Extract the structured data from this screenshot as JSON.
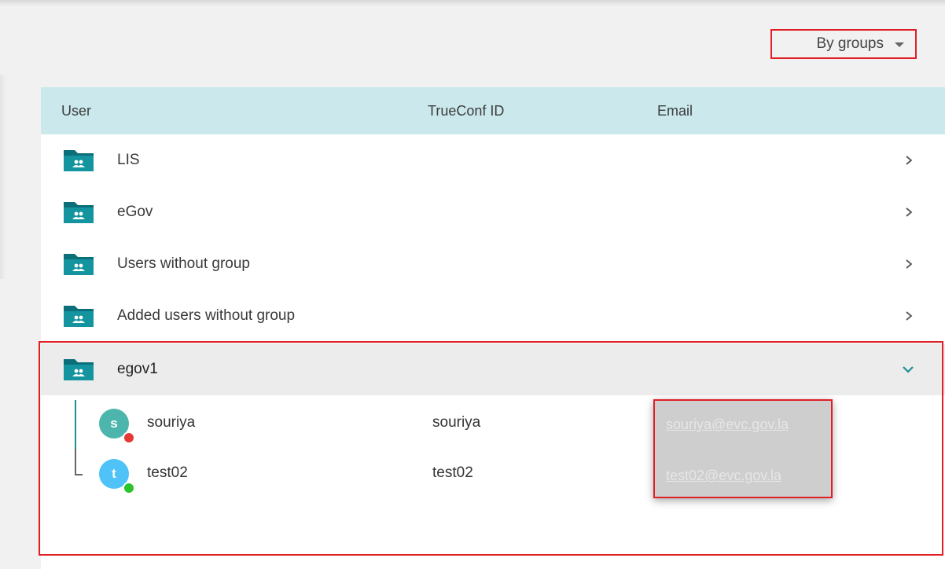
{
  "view_selector": {
    "label": "By groups"
  },
  "table": {
    "columns": {
      "user": "User",
      "trueconf_id": "TrueConf ID",
      "email": "Email"
    }
  },
  "groups": [
    {
      "name": "LIS",
      "state": "collapsed"
    },
    {
      "name": "eGov",
      "state": "collapsed"
    },
    {
      "name": "Users without group",
      "state": "collapsed"
    },
    {
      "name": "Added users without group",
      "state": "collapsed"
    },
    {
      "name": "egov1",
      "state": "expanded"
    }
  ],
  "users": [
    {
      "initial": "s",
      "name": "souriya",
      "trueconf_id": "souriya",
      "email": "souriya@evc.gov.la",
      "avatar_color": "#4db6ac",
      "status": "offline",
      "status_color": "#e53935"
    },
    {
      "initial": "t",
      "name": "test02",
      "trueconf_id": "test02",
      "email": "test02@evc.gov.la",
      "avatar_color": "#4fc3f7",
      "status": "online",
      "status_color": "#2bc42b"
    }
  ],
  "colors": {
    "accent": "#1a8f97",
    "header_bg": "#cbe9ec",
    "highlight": "#e01f26"
  }
}
